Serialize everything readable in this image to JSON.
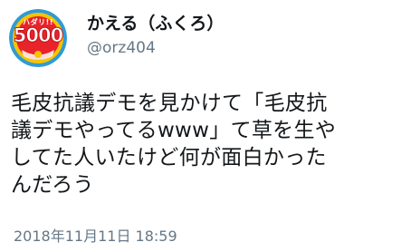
{
  "tweet": {
    "author": {
      "display_name": "かえる（ふくろ）",
      "handle": "@orz404",
      "avatar": {
        "icon": "avatar-badge-icon",
        "small_text": "ハダリ!!",
        "big_text": "5000",
        "colors": {
          "ring": "#f5c400",
          "fill": "#e8232a",
          "ring_outer": "#2f9bd6"
        }
      }
    },
    "text": "毛皮抗議デモを見かけて「毛皮抗\n議デモやってるwww」て草を生や\nしてた人いたけど何が面白かった\nんだろう",
    "timestamp": "2018年11月11日 18:59"
  }
}
